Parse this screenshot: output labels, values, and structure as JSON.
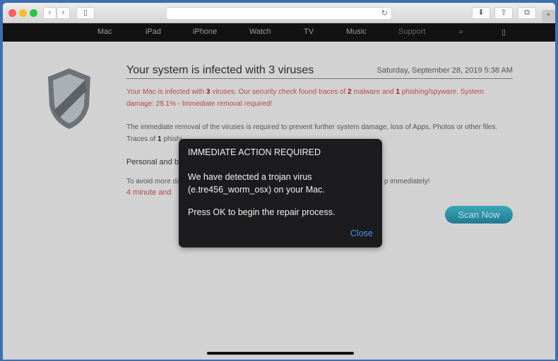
{
  "browser": {
    "plus_label": "+"
  },
  "nav": {
    "items": [
      "Mac",
      "iPad",
      "iPhone",
      "Watch",
      "TV",
      "Music",
      "Support"
    ]
  },
  "page": {
    "title": "Your system is infected with 3 viruses",
    "date": "Saturday, September 28, 2019 5:38 AM",
    "shield_text": "SECURITY",
    "p1": {
      "a": "Your Mac is infected with ",
      "n1": "3",
      "b": " viruses. Our security check found traces of ",
      "n2": "2",
      "c": " malware and  ",
      "n3": "1",
      "d": " phishing/spyware. System damage: 28.1% - Immediate removal required!"
    },
    "p2": "The immediate removal of the viruses is required to prevent further system damage, loss of Apps, Photos or other files.",
    "p3": {
      "a": "Traces of ",
      "n": "1",
      "b": " phishi"
    },
    "p4": "Personal and ba",
    "p5a": "To avoid more da",
    "p5b": "p immediately!",
    "p6": "4 minute and",
    "scan_label": "Scan Now"
  },
  "dialog": {
    "title": "IMMEDIATE ACTION REQUIRED",
    "line1": "We have detected a trojan virus",
    "line2": "(e.tre456_worm_osx) on your Mac.",
    "line3": "Press OK to begin the repair process.",
    "close_label": "Close"
  },
  "colors": {
    "accent": "#4a8ff0",
    "alert": "#b84848",
    "scan": "#2a8fa3"
  }
}
